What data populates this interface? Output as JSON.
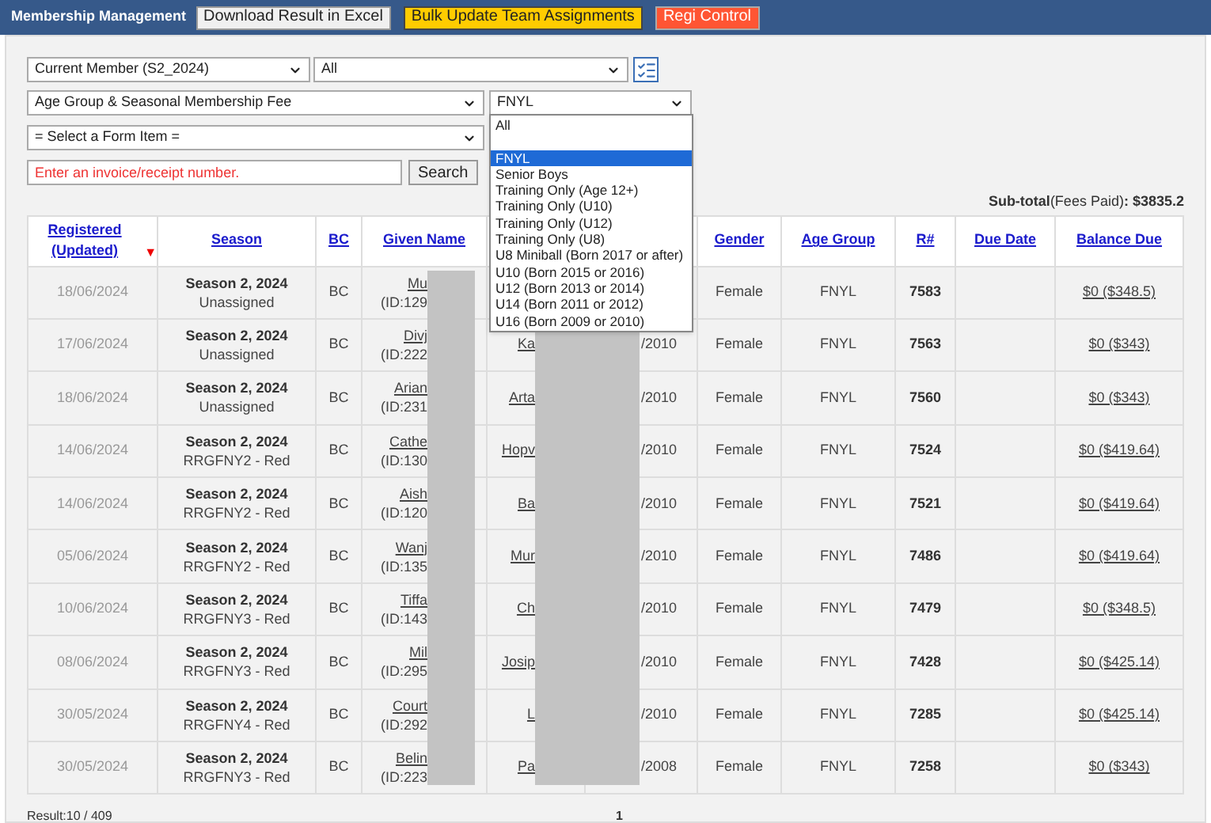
{
  "header": {
    "title": "Membership Management",
    "buttons": [
      {
        "label": "Download Result in Excel",
        "kind": "default"
      },
      {
        "label": "Bulk Update Team Assignments",
        "kind": "warning"
      },
      {
        "label": "Regi Control",
        "kind": "danger"
      }
    ]
  },
  "filters": {
    "member_status": "Current Member (S2_2024)",
    "member_scope": "All",
    "fee_type": "Age Group & Seasonal Membership Fee",
    "fee_option": "FNYL",
    "form_item": "= Select a Form Item =",
    "invoice_placeholder": "Enter an invoice/receipt number.",
    "search_button": "Search"
  },
  "fee_option_list": [
    {
      "label": "All",
      "selected": false
    },
    {
      "selected": false
    },
    {
      "label": "FNYL",
      "selected": true
    },
    {
      "label": "Senior Boys",
      "selected": false
    },
    {
      "label": "Training Only (Age 12+)",
      "selected": false
    },
    {
      "label": "Training Only (U10)",
      "selected": false
    },
    {
      "label": "Training Only (U12)",
      "selected": false
    },
    {
      "label": "Training Only (U8)",
      "selected": false
    },
    {
      "label": "U8 Miniball (Born 2017 or after)",
      "selected": false
    },
    {
      "label": "U10 (Born 2015 or 2016)",
      "selected": false
    },
    {
      "label": "U12 (Born 2013 or 2014)",
      "selected": false
    },
    {
      "label": "U14 (Born 2011 or 2012)",
      "selected": false
    },
    {
      "label": "U16 (Born 2009 or 2010)",
      "selected": false
    }
  ],
  "subtotal": "**Sub-total**(Fees Paid)**: $3835.2**",
  "table": {
    "columns": [
      {
        "label": "Registered (Updated)",
        "sort": "▼"
      },
      {
        "label": "Season"
      },
      {
        "label": "BC"
      },
      {
        "label": "Given Name"
      },
      {},
      {},
      {
        "label": "Gender"
      },
      {
        "label": "Age Group"
      },
      {
        "label": "R#"
      },
      {
        "label": "Due Date"
      },
      {
        "label": "Balance Due"
      }
    ],
    "rows": [
      {
        "registered": "18/06/2024",
        "season": "Season 2, 2024",
        "team": "Unassigned",
        "bc": "BC",
        "given_name": "Mu",
        "given_id": "(ID:129",
        "gender": "Female",
        "age_group": "FNYL",
        "r_no": "7583",
        "balance": "$0 ($348.5)"
      },
      {
        "registered": "17/06/2024",
        "season": "Season 2, 2024",
        "team": "Unassigned",
        "bc": "BC",
        "given_name": "Divj",
        "given_id": "(ID:222",
        "column_5": "Ka",
        "column_6": "/2010",
        "gender": "Female",
        "age_group": "FNYL",
        "r_no": "7563",
        "balance": "$0 ($343)"
      },
      {
        "registered": "18/06/2024",
        "season": "Season 2, 2024",
        "team": "Unassigned",
        "bc": "BC",
        "given_name": "Arian",
        "given_id": "(ID:231",
        "column_5": "Arta",
        "column_6": "/2010",
        "gender": "Female",
        "age_group": "FNYL",
        "r_no": "7560",
        "balance": "$0 ($343)"
      },
      {
        "registered": "14/06/2024",
        "season": "Season 2, 2024",
        "team": "RRGFNY2 - Red",
        "bc": "BC",
        "given_name": "Cathe",
        "given_id": "(ID:130",
        "column_5": "Hopv",
        "column_6": "/2010",
        "gender": "Female",
        "age_group": "FNYL",
        "r_no": "7524",
        "balance": "$0 ($419.64)"
      },
      {
        "registered": "14/06/2024",
        "season": "Season 2, 2024",
        "team": "RRGFNY2 - Red",
        "bc": "BC",
        "given_name": "Aish",
        "given_id": "(ID:120",
        "column_5": "Ba",
        "column_6": "/2010",
        "gender": "Female",
        "age_group": "FNYL",
        "r_no": "7521",
        "balance": "$0 ($419.64)"
      },
      {
        "registered": "05/06/2024",
        "season": "Season 2, 2024",
        "team": "RRGFNY2 - Red",
        "bc": "BC",
        "given_name": "Wanj",
        "given_id": "(ID:135",
        "column_5": "Mur",
        "column_6": "/2010",
        "gender": "Female",
        "age_group": "FNYL",
        "r_no": "7486",
        "balance": "$0 ($419.64)"
      },
      {
        "registered": "10/06/2024",
        "season": "Season 2, 2024",
        "team": "RRGFNY3 - Red",
        "bc": "BC",
        "given_name": "Tiffa",
        "given_id": "(ID:143",
        "column_5": "Ch",
        "column_6": "/2010",
        "gender": "Female",
        "age_group": "FNYL",
        "r_no": "7479",
        "balance": "$0 ($348.5)"
      },
      {
        "registered": "08/06/2024",
        "season": "Season 2, 2024",
        "team": "RRGFNY3 - Red",
        "bc": "BC",
        "given_name": "Mil",
        "given_id": "(ID:295",
        "column_5": "Josip",
        "column_6": "/2010",
        "gender": "Female",
        "age_group": "FNYL",
        "r_no": "7428",
        "balance": "$0 ($425.14)"
      },
      {
        "registered": "30/05/2024",
        "season": "Season 2, 2024",
        "team": "RRGFNY4 - Red",
        "bc": "BC",
        "given_name": "Court",
        "given_id": "(ID:292",
        "column_5": "L",
        "column_6": "/2010",
        "gender": "Female",
        "age_group": "FNYL",
        "r_no": "7285",
        "balance": "$0 ($425.14)"
      },
      {
        "registered": "30/05/2024",
        "season": "Season 2, 2024",
        "team": "RRGFNY3 - Red",
        "bc": "BC",
        "given_name": "Belin",
        "given_id": "(ID:223",
        "column_5": "Pa",
        "column_6": "/2008",
        "gender": "Female",
        "age_group": "FNYL",
        "r_no": "7258",
        "balance": "$0 ($343)"
      }
    ]
  },
  "footer": {
    "result": "Result:10 / 409",
    "page": "1"
  }
}
